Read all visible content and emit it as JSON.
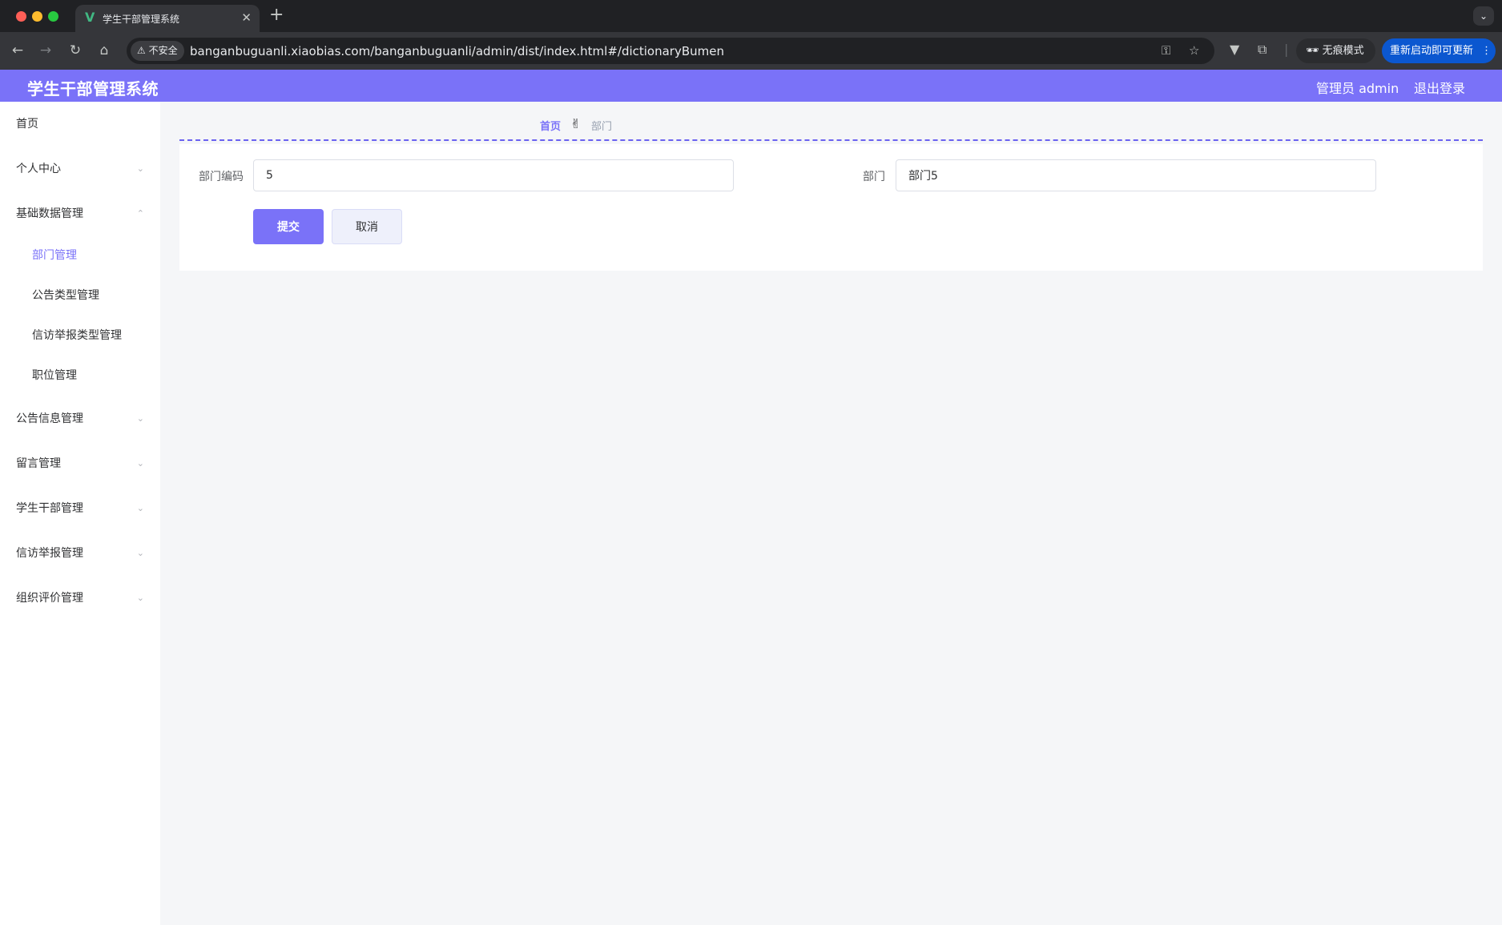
{
  "browser": {
    "tab_title": "学生干部管理系统",
    "tab_close": "✕",
    "new_tab": "+",
    "insecure_label": "不安全",
    "url": "banganbuguanli.xiaobias.com/banganbuguanli/admin/dist/index.html#/dictionaryBumen",
    "incognito_label": "无痕模式",
    "update_label": "重新启动即可更新"
  },
  "header": {
    "title": "学生干部管理系统",
    "user": "管理员 admin",
    "logout": "退出登录",
    "accent_color": "#7a72f8"
  },
  "sidebar": {
    "items": [
      {
        "label": "首页",
        "expandable": false
      },
      {
        "label": "个人中心",
        "expandable": true,
        "expanded": false
      },
      {
        "label": "基础数据管理",
        "expandable": true,
        "expanded": true
      },
      {
        "label": "部门管理",
        "sub": true,
        "active": true
      },
      {
        "label": "公告类型管理",
        "sub": true
      },
      {
        "label": "信访举报类型管理",
        "sub": true
      },
      {
        "label": "职位管理",
        "sub": true
      },
      {
        "label": "公告信息管理",
        "expandable": true,
        "expanded": false
      },
      {
        "label": "留言管理",
        "expandable": true,
        "expanded": false
      },
      {
        "label": "学生干部管理",
        "expandable": true,
        "expanded": false
      },
      {
        "label": "信访举报管理",
        "expandable": true,
        "expanded": false
      },
      {
        "label": "组织评价管理",
        "expandable": true,
        "expanded": false
      }
    ]
  },
  "breadcrumb": {
    "home": "首页",
    "separator": "✌",
    "current": "部门"
  },
  "form": {
    "code_label": "部门编码",
    "code_value": "5",
    "name_label": "部门",
    "name_value": "部门5",
    "submit": "提交",
    "cancel": "取消"
  }
}
